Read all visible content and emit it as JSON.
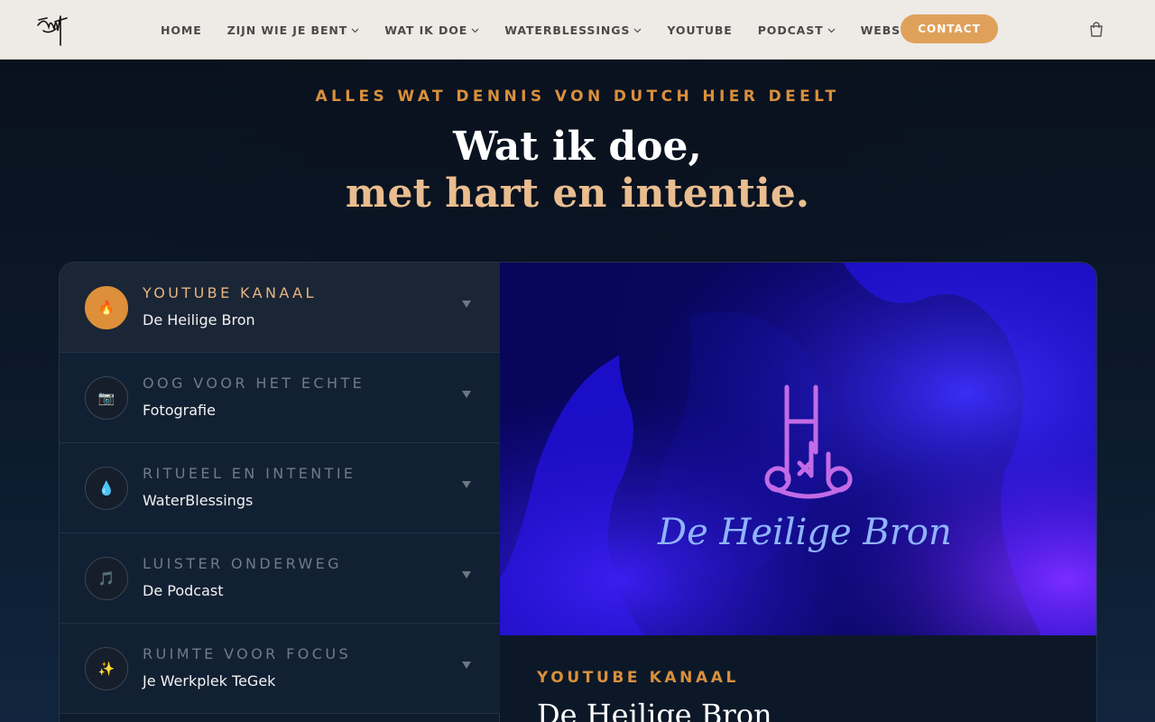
{
  "nav": {
    "items": [
      {
        "label": "HOME",
        "has_dropdown": false
      },
      {
        "label": "ZIJN WIE JE BENT",
        "has_dropdown": true
      },
      {
        "label": "WAT IK DOE",
        "has_dropdown": true
      },
      {
        "label": "WATERBLESSINGS",
        "has_dropdown": true
      },
      {
        "label": "YOUTUBE",
        "has_dropdown": false
      },
      {
        "label": "PODCAST",
        "has_dropdown": true
      },
      {
        "label": "WEBSHOP",
        "has_dropdown": true
      }
    ],
    "contact_label": "CONTACT",
    "cart_icon": "shopping-bag-icon",
    "accent_color": "#dfa15a"
  },
  "hero": {
    "eyebrow": "ALLES WAT DENNIS VON DUTCH HIER DEELT",
    "title_line1": "Wat ik doe,",
    "title_line2": "met hart en intentie."
  },
  "accordion": {
    "items": [
      {
        "kicker": "YOUTUBE KANAAL",
        "label": "De Heilige Bron",
        "icon": "fire-icon",
        "glyph": "🔥",
        "active": true
      },
      {
        "kicker": "OOG VOOR HET ECHTE",
        "label": "Fotografie",
        "icon": "camera-icon",
        "glyph": "📷",
        "active": false
      },
      {
        "kicker": "RITUEEL EN INTENTIE",
        "label": "WaterBlessings",
        "icon": "water-drop-icon",
        "glyph": "💧",
        "active": false
      },
      {
        "kicker": "LUISTER ONDERWEG",
        "label": "De Podcast",
        "icon": "music-note-icon",
        "glyph": "🎵",
        "active": false
      },
      {
        "kicker": "RUIMTE VOOR FOCUS",
        "label": "Je Werkplek TeGek",
        "icon": "sparkles-icon",
        "glyph": "✨",
        "active": false
      }
    ]
  },
  "feature": {
    "image_text": "De Heilige Bron",
    "kicker": "YOUTUBE KANAAL",
    "title": "De Heilige Bron"
  }
}
